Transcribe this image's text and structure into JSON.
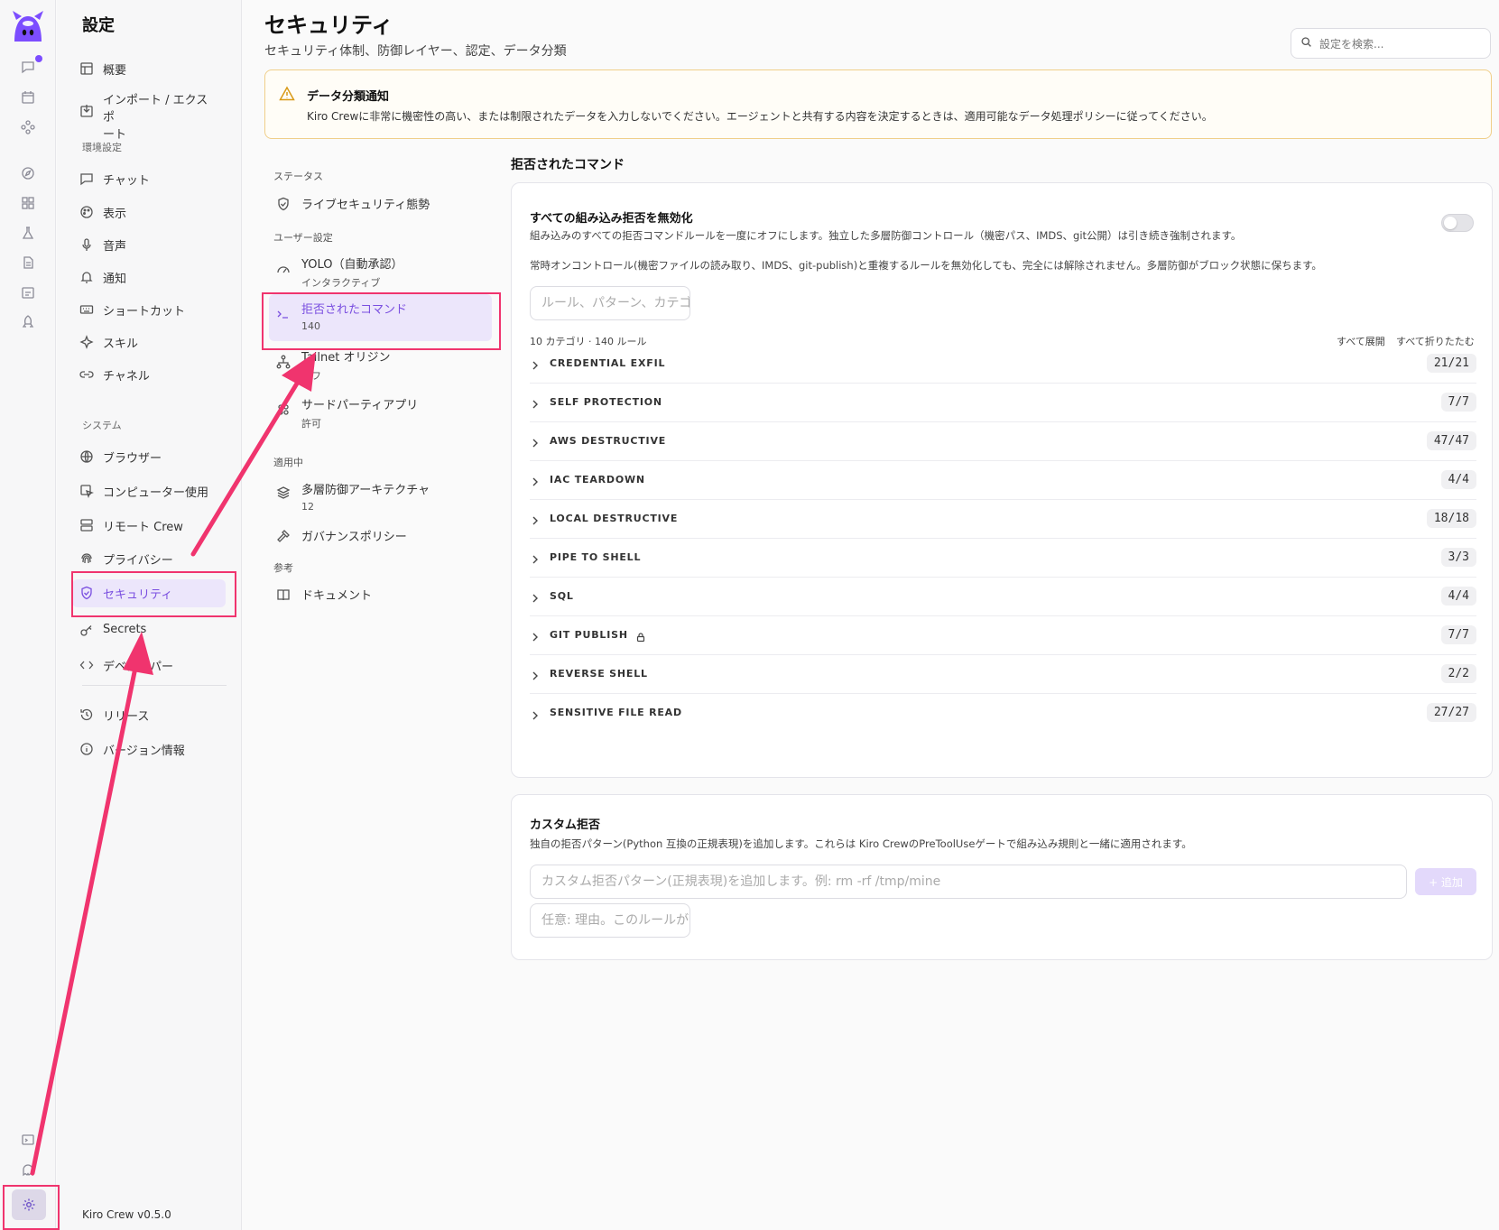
{
  "app": {
    "version": "Kiro Crew v0.5.0"
  },
  "sidebar": {
    "title": "設定",
    "top_items": [
      {
        "label": "概要",
        "icon": "layout-icon"
      },
      {
        "label": "インポート / エクスポ\nート",
        "icon": "import-icon"
      }
    ],
    "env_section": "環境設定",
    "env_items": [
      {
        "label": "チャット",
        "icon": "chat-icon"
      },
      {
        "label": "表示",
        "icon": "palette-icon"
      },
      {
        "label": "音声",
        "icon": "mic-icon"
      },
      {
        "label": "通知",
        "icon": "bell-icon"
      },
      {
        "label": "ショートカット",
        "icon": "keyboard-icon"
      },
      {
        "label": "スキル",
        "icon": "sparkles-icon"
      },
      {
        "label": "チャネル",
        "icon": "link-icon"
      }
    ],
    "system_section": "システム",
    "system_items": [
      {
        "label": "ブラウザー",
        "icon": "globe-icon"
      },
      {
        "label": "コンピューター使用",
        "icon": "cursor-icon"
      },
      {
        "label": "リモート Crew",
        "icon": "server-icon"
      },
      {
        "label": "プライバシー",
        "icon": "fingerprint-icon"
      },
      {
        "label": "セキュリティ",
        "icon": "shield-icon",
        "active": true
      },
      {
        "label": "Secrets",
        "icon": "key-icon"
      },
      {
        "label": "デベロッパー",
        "icon": "code-icon"
      }
    ],
    "bottom_items": [
      {
        "label": "リリース",
        "icon": "history-icon"
      },
      {
        "label": "バージョン情報",
        "icon": "info-icon"
      }
    ]
  },
  "header": {
    "title": "セキュリティ",
    "subtitle": "セキュリティ体制、防御レイヤー、認定、データ分類",
    "search_placeholder": "設定を検索..."
  },
  "notice": {
    "title": "データ分類通知",
    "body": "Kiro Crewに非常に機密性の高い、または制限されたデータを入力しないでください。エージェントと共有する内容を決定するときは、適用可能なデータ処理ポリシーに従ってください。"
  },
  "subnav": {
    "status_section": "ステータス",
    "live_posture": "ライブセキュリティ態勢",
    "user_section": "ユーザー設定",
    "yolo_label": "YOLO（自動承認）",
    "yolo_sub": "インタラクティブ",
    "denied_label": "拒否されたコマンド",
    "denied_sub": "140",
    "tailnet_label": "Tailnet オリジン",
    "tailnet_sub": "オフ",
    "third_label": "サードパーティアプリ",
    "third_sub": "許可",
    "applied_section": "適用中",
    "defense_label": "多層防御アーキテクチャ",
    "defense_sub": "12",
    "governance_label": "ガバナンスポリシー",
    "ref_section": "参考",
    "docs_label": "ドキュメント"
  },
  "denied": {
    "heading": "拒否されたコマンド",
    "disable_title": "すべての組み込み拒否を無効化",
    "disable_desc": "組み込みのすべての拒否コマンドルールを一度にオフにします。独立した多層防御コントロール（機密パス、IMDS、git公開）は引き続き強制されます。",
    "disable_note": "常時オンコントロール(機密ファイルの読み取り、IMDS、git-publish)と重複するルールを無効化しても、完全には解除されません。多層防御がブロック状態に保ちます。",
    "toggle_on": false,
    "filter_placeholder": "ルール、パターン、カテゴリ",
    "meta": "10 カテゴリ · 140 ルール",
    "expand_all": "すべて展開",
    "collapse_all": "すべて折りたたむ",
    "categories": [
      {
        "name": "CREDENTIAL EXFIL",
        "count": "21/21"
      },
      {
        "name": "SELF PROTECTION",
        "count": "7/7"
      },
      {
        "name": "AWS DESTRUCTIVE",
        "count": "47/47"
      },
      {
        "name": "IAC TEARDOWN",
        "count": "4/4"
      },
      {
        "name": "LOCAL DESTRUCTIVE",
        "count": "18/18"
      },
      {
        "name": "PIPE TO SHELL",
        "count": "3/3"
      },
      {
        "name": "SQL",
        "count": "4/4"
      },
      {
        "name": "GIT PUBLISH",
        "count": "7/7",
        "locked": true
      },
      {
        "name": "REVERSE SHELL",
        "count": "2/2"
      },
      {
        "name": "SENSITIVE FILE READ",
        "count": "27/27"
      }
    ]
  },
  "custom": {
    "title": "カスタム拒否",
    "desc": "独自の拒否パターン(Python 互換の正規表現)を追加します。これらは Kiro CrewのPreToolUseゲートで組み込み規則と一緒に適用されます。",
    "pattern_placeholder": "カスタム拒否パターン(正規表現)を追加します。例: rm -rf /tmp/mine",
    "reason_placeholder": "任意: 理由。このルールが",
    "add_label": "+ 追加"
  },
  "colors": {
    "accent": "#7a4fe0",
    "highlight": "#f0346e",
    "warning": "#d99a17"
  }
}
